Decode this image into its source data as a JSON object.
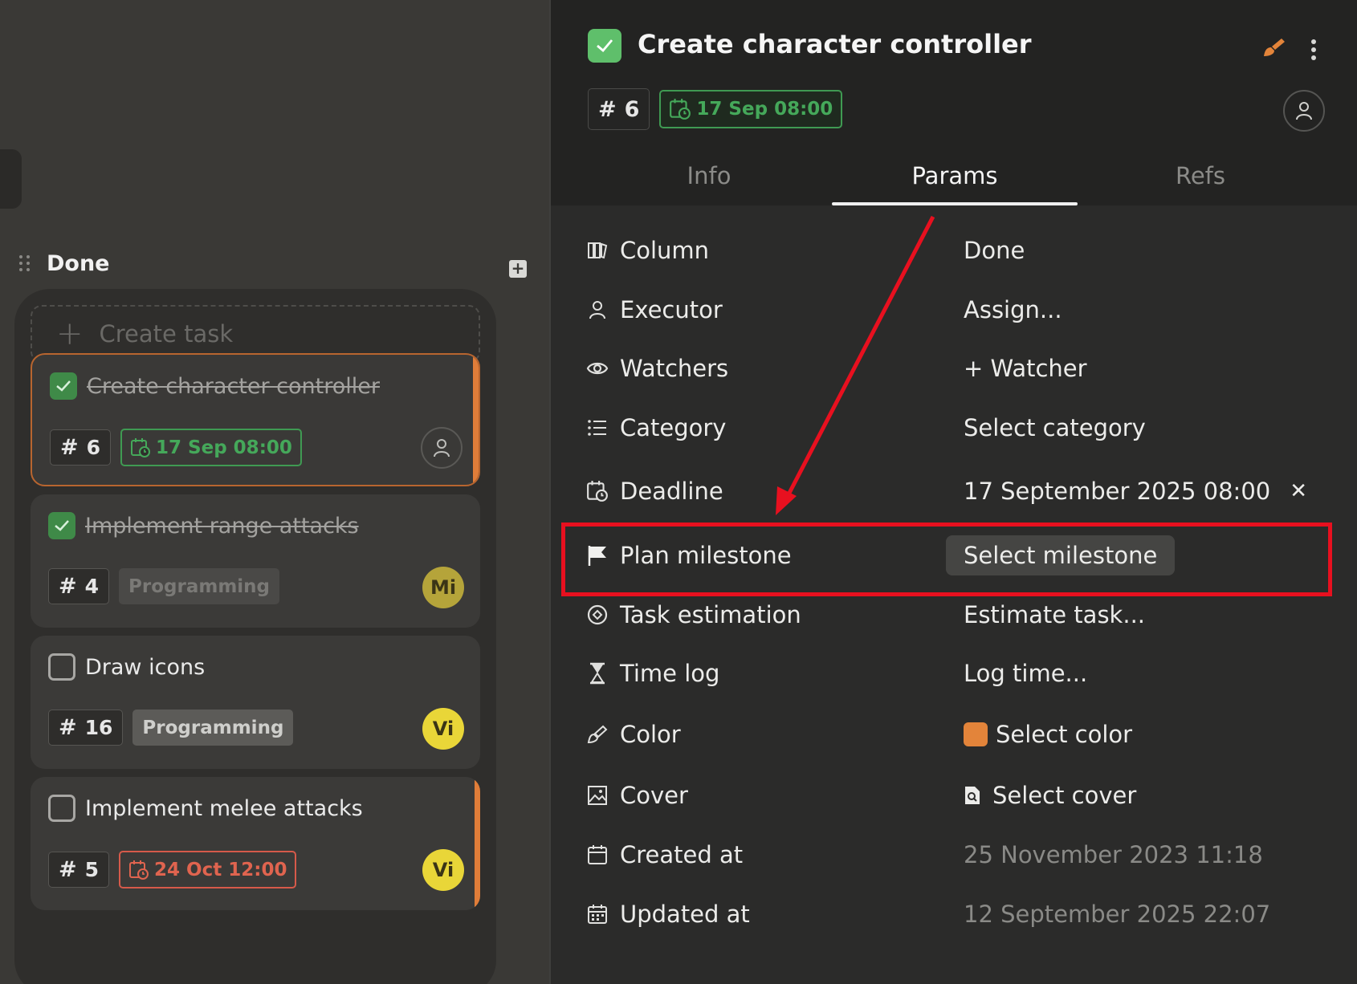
{
  "board": {
    "column_title": "Done",
    "create_task_label": "Create task",
    "cards": [
      {
        "title": "Create character controller",
        "number": "6",
        "date": "17 Sep 08:00",
        "done": true
      },
      {
        "title": "Implement range attacks",
        "number": "4",
        "tag": "Programming",
        "avatar": "Mi",
        "done": true
      },
      {
        "title": "Draw icons",
        "number": "16",
        "tag": "Programming",
        "avatar": "Vi",
        "done": false
      },
      {
        "title": "Implement melee attacks",
        "number": "5",
        "date": "24 Oct 12:00",
        "avatar": "Vi",
        "done": false
      }
    ]
  },
  "panel": {
    "title": "Create character controller",
    "number": "6",
    "deadline_chip": "17 Sep 08:00",
    "tabs": [
      "Info",
      "Params",
      "Refs"
    ],
    "active_tab": "Params",
    "params": [
      {
        "label": "Column",
        "value": "Done",
        "icon": "columns-icon"
      },
      {
        "label": "Executor",
        "value": "Assign...",
        "icon": "user-icon"
      },
      {
        "label": "Watchers",
        "value": "+ Watcher",
        "icon": "eye-icon"
      },
      {
        "label": "Category",
        "value": "Select category",
        "icon": "list-icon"
      },
      {
        "label": "Deadline",
        "value": "17 September 2025 08:00",
        "icon": "calendar-clock-icon"
      },
      {
        "label": "Plan milestone",
        "value": "Select milestone",
        "icon": "flag-icon"
      },
      {
        "label": "Task estimation",
        "value": "Estimate task...",
        "icon": "target-icon"
      },
      {
        "label": "Time log",
        "value": "Log time...",
        "icon": "hourglass-icon"
      },
      {
        "label": "Color",
        "value": "Select color",
        "icon": "brush-icon"
      },
      {
        "label": "Cover",
        "value": "Select cover",
        "icon": "image-icon"
      },
      {
        "label": "Created at",
        "value": "25 November 2023 11:18",
        "icon": "calendar-icon"
      },
      {
        "label": "Updated at",
        "value": "12 September 2025 22:07",
        "icon": "calendar-grid-icon"
      }
    ]
  },
  "colors": {
    "accent_green": "#45a85a",
    "accent_orange": "#e3843a",
    "highlight_red": "#e8101f",
    "overdue_red": "#e0644f"
  }
}
